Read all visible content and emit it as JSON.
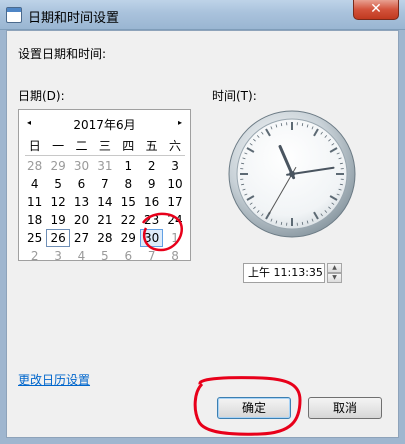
{
  "window": {
    "title": "日期和时间设置",
    "close_glyph": "✕"
  },
  "dialog": {
    "heading": "设置日期和时间:",
    "date_label": "日期(D):",
    "time_label": "时间(T):",
    "link": "更改日历设置",
    "ok": "确定",
    "cancel": "取消"
  },
  "calendar": {
    "month_title": "2017年6月",
    "prev_glyph": "◂",
    "next_glyph": "▸",
    "weekdays": [
      "日",
      "一",
      "二",
      "三",
      "四",
      "五",
      "六"
    ],
    "weeks": [
      [
        {
          "d": "28",
          "m": true
        },
        {
          "d": "29",
          "m": true
        },
        {
          "d": "30",
          "m": true
        },
        {
          "d": "31",
          "m": true
        },
        {
          "d": "1"
        },
        {
          "d": "2"
        },
        {
          "d": "3"
        }
      ],
      [
        {
          "d": "4"
        },
        {
          "d": "5"
        },
        {
          "d": "6"
        },
        {
          "d": "7"
        },
        {
          "d": "8"
        },
        {
          "d": "9"
        },
        {
          "d": "10"
        }
      ],
      [
        {
          "d": "11"
        },
        {
          "d": "12"
        },
        {
          "d": "13"
        },
        {
          "d": "14"
        },
        {
          "d": "15"
        },
        {
          "d": "16"
        },
        {
          "d": "17"
        }
      ],
      [
        {
          "d": "18"
        },
        {
          "d": "19"
        },
        {
          "d": "20"
        },
        {
          "d": "21"
        },
        {
          "d": "22"
        },
        {
          "d": "23"
        },
        {
          "d": "24"
        }
      ],
      [
        {
          "d": "25"
        },
        {
          "d": "26",
          "today": true
        },
        {
          "d": "27"
        },
        {
          "d": "28"
        },
        {
          "d": "29"
        },
        {
          "d": "30",
          "sel": true
        },
        {
          "d": "1",
          "m": true
        }
      ],
      [
        {
          "d": "2",
          "m": true
        },
        {
          "d": "3",
          "m": true
        },
        {
          "d": "4",
          "m": true
        },
        {
          "d": "5",
          "m": true
        },
        {
          "d": "6",
          "m": true
        },
        {
          "d": "7",
          "m": true
        },
        {
          "d": "8",
          "m": true
        }
      ]
    ]
  },
  "clock": {
    "hour": 11,
    "minute": 13,
    "second": 35
  },
  "time": {
    "value": "上午 11:13:35"
  },
  "annotations": {
    "color": "#e8001a"
  }
}
